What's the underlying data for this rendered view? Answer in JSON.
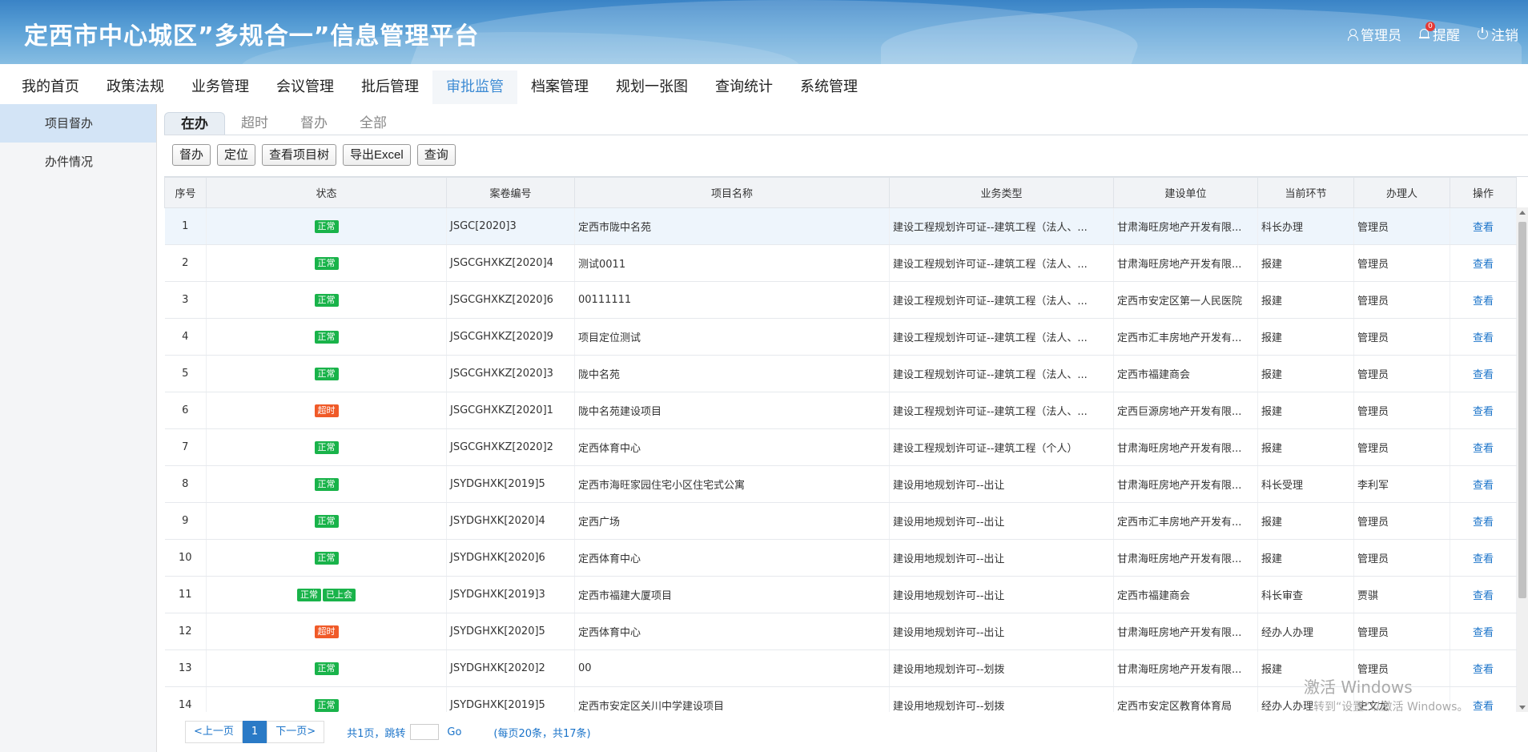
{
  "header": {
    "title": "定西市中心城区”多规合一”信息管理平台",
    "user_label": "管理员",
    "remind_label": "提醒",
    "remind_count": "0",
    "logout_label": "注销"
  },
  "nav": {
    "items": [
      "我的首页",
      "政策法规",
      "业务管理",
      "会议管理",
      "批后管理",
      "审批监管",
      "档案管理",
      "规划一张图",
      "查询统计",
      "系统管理"
    ],
    "active": "审批监管"
  },
  "sidebar": {
    "items": [
      "项目督办",
      "办件情况"
    ],
    "active": "项目督办"
  },
  "subtabs": {
    "items": [
      "在办",
      "超时",
      "督办",
      "全部"
    ],
    "active": "在办"
  },
  "toolbar": {
    "buttons": [
      "督办",
      "定位",
      "查看项目树",
      "导出Excel",
      "查询"
    ]
  },
  "table": {
    "columns": [
      "序号",
      "状态",
      "案卷编号",
      "项目名称",
      "业务类型",
      "建设单位",
      "当前环节",
      "办理人",
      "操作"
    ],
    "rows": [
      {
        "no": "1",
        "status": [
          "正常"
        ],
        "code": "JSGC[2020]3",
        "name": "定西市陇中名苑",
        "type": "建设工程规划许可证--建筑工程（法人、...",
        "unit": "甘肃海旺房地产开发有限...",
        "step": "科长办理",
        "handler": "管理员",
        "op": "查看"
      },
      {
        "no": "2",
        "status": [
          "正常"
        ],
        "code": "JSGCGHXKZ[2020]4",
        "name": "测试0011",
        "type": "建设工程规划许可证--建筑工程（法人、...",
        "unit": "甘肃海旺房地产开发有限...",
        "step": "报建",
        "handler": "管理员",
        "op": "查看"
      },
      {
        "no": "3",
        "status": [
          "正常"
        ],
        "code": "JSGCGHXKZ[2020]6",
        "name": "00111111",
        "type": "建设工程规划许可证--建筑工程（法人、...",
        "unit": "定西市安定区第一人民医院",
        "step": "报建",
        "handler": "管理员",
        "op": "查看"
      },
      {
        "no": "4",
        "status": [
          "正常"
        ],
        "code": "JSGCGHXKZ[2020]9",
        "name": "项目定位测试",
        "type": "建设工程规划许可证--建筑工程（法人、...",
        "unit": "定西市汇丰房地产开发有...",
        "step": "报建",
        "handler": "管理员",
        "op": "查看"
      },
      {
        "no": "5",
        "status": [
          "正常"
        ],
        "code": "JSGCGHXKZ[2020]3",
        "name": "陇中名苑",
        "type": "建设工程规划许可证--建筑工程（法人、...",
        "unit": "定西市福建商会",
        "step": "报建",
        "handler": "管理员",
        "op": "查看"
      },
      {
        "no": "6",
        "status": [
          "超时"
        ],
        "code": "JSGCGHXKZ[2020]1",
        "name": "陇中名苑建设项目",
        "type": "建设工程规划许可证--建筑工程（法人、...",
        "unit": "定西巨源房地产开发有限...",
        "step": "报建",
        "handler": "管理员",
        "op": "查看"
      },
      {
        "no": "7",
        "status": [
          "正常"
        ],
        "code": "JSGCGHXKZ[2020]2",
        "name": "定西体育中心",
        "type": "建设工程规划许可证--建筑工程（个人）",
        "unit": "甘肃海旺房地产开发有限...",
        "step": "报建",
        "handler": "管理员",
        "op": "查看"
      },
      {
        "no": "8",
        "status": [
          "正常"
        ],
        "code": "JSYDGHXK[2019]5",
        "name": "定西市海旺家园住宅小区住宅式公寓",
        "type": "建设用地规划许可--出让",
        "unit": "甘肃海旺房地产开发有限...",
        "step": "科长受理",
        "handler": "李利军",
        "op": "查看"
      },
      {
        "no": "9",
        "status": [
          "正常"
        ],
        "code": "JSYDGHXK[2020]4",
        "name": "定西广场",
        "type": "建设用地规划许可--出让",
        "unit": "定西市汇丰房地产开发有...",
        "step": "报建",
        "handler": "管理员",
        "op": "查看"
      },
      {
        "no": "10",
        "status": [
          "正常"
        ],
        "code": "JSYDGHXK[2020]6",
        "name": "定西体育中心",
        "type": "建设用地规划许可--出让",
        "unit": "甘肃海旺房地产开发有限...",
        "step": "报建",
        "handler": "管理员",
        "op": "查看"
      },
      {
        "no": "11",
        "status": [
          "正常",
          "已上会"
        ],
        "code": "JSYDGHXK[2019]3",
        "name": "定西市福建大厦项目",
        "type": "建设用地规划许可--出让",
        "unit": "定西市福建商会",
        "step": "科长审查",
        "handler": "贾骐",
        "op": "查看"
      },
      {
        "no": "12",
        "status": [
          "超时"
        ],
        "code": "JSYDGHXK[2020]5",
        "name": "定西体育中心",
        "type": "建设用地规划许可--出让",
        "unit": "甘肃海旺房地产开发有限...",
        "step": "经办人办理",
        "handler": "管理员",
        "op": "查看"
      },
      {
        "no": "13",
        "status": [
          "正常"
        ],
        "code": "JSYDGHXK[2020]2",
        "name": "00",
        "type": "建设用地规划许可--划拨",
        "unit": "甘肃海旺房地产开发有限...",
        "step": "报建",
        "handler": "管理员",
        "op": "查看"
      },
      {
        "no": "14",
        "status": [
          "正常"
        ],
        "code": "JSYDGHXK[2019]5",
        "name": "定西市安定区关川中学建设项目",
        "type": "建设用地规划许可--划拨",
        "unit": "定西市安定区教育体育局",
        "step": "经办人办理",
        "handler": "史文龙",
        "op": "查看"
      }
    ]
  },
  "pager": {
    "prev": "<上一页",
    "current": "1",
    "next": "下一页>",
    "jump_text": "共1页，跳转",
    "go": "Go",
    "info": "(每页20条，共17条)"
  },
  "watermark": {
    "line1": "激活 Windows",
    "line2": "转到“设置”以激活 Windows。"
  },
  "colors": {
    "ok": "#19b34a",
    "late": "#f05a28",
    "accent": "#3d8bd4"
  }
}
